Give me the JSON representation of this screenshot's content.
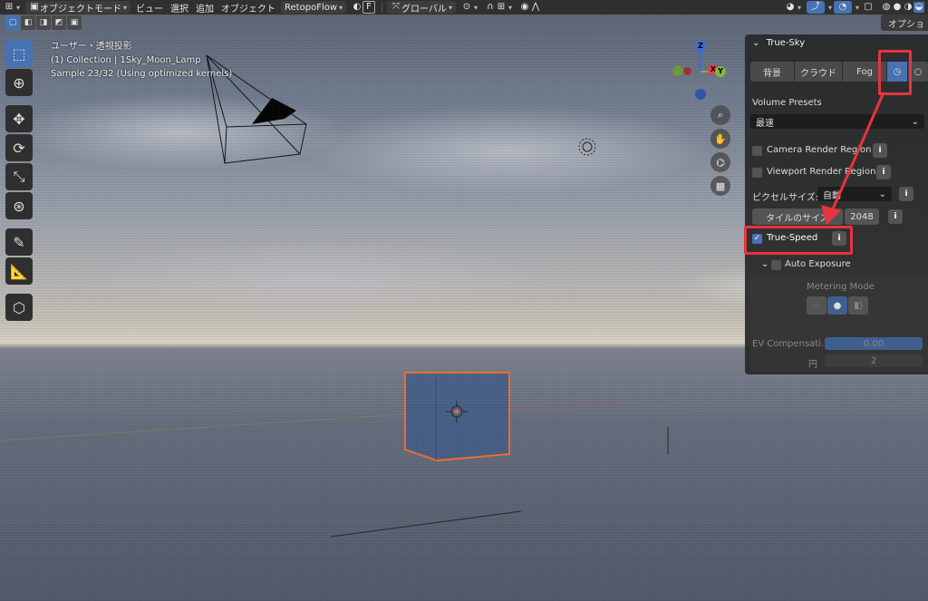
{
  "header": {
    "mode": "オブジェクトモード",
    "menu": [
      "ビュー",
      "選択",
      "追加",
      "オブジェクト"
    ],
    "addon": "RetopoFlow",
    "addon_badge": "F",
    "orientation": "グローバル"
  },
  "tabs": {
    "options": "オプショ"
  },
  "viewport": {
    "view_name": "ユーザー・透視投影",
    "collection": "(1) Collection | 1Sky_Moon_Lamp",
    "sample": "Sample 23/32 (Using optimized kernels)"
  },
  "gizmo": {
    "z": "Z",
    "x": "X",
    "y": "Y"
  },
  "panel": {
    "title": "True-Sky",
    "tabs": [
      "背景",
      "クラウド",
      "Fog"
    ],
    "volume_presets_label": "Volume Presets",
    "volume_presets_value": "最速",
    "camera_render_region": "Camera Render Region",
    "viewport_render_region": "Viewport Render Region",
    "pixel_size_label": "ピクセルサイズ:",
    "pixel_size_value": "自動",
    "tile_size_label": "タイルのサイズ",
    "tile_size_value": "2048",
    "true_speed": "True-Speed",
    "auto_exposure": "Auto Exposure",
    "metering_mode": "Metering Mode",
    "ev_label": "EV Compensati...",
    "ev_value": "0.00",
    "circle_label": "円",
    "circle_value": "2",
    "info_glyph": "i"
  },
  "colors": {
    "accent": "#4772b3",
    "highlight": "#e8333f",
    "selection": "#f06a2a"
  }
}
